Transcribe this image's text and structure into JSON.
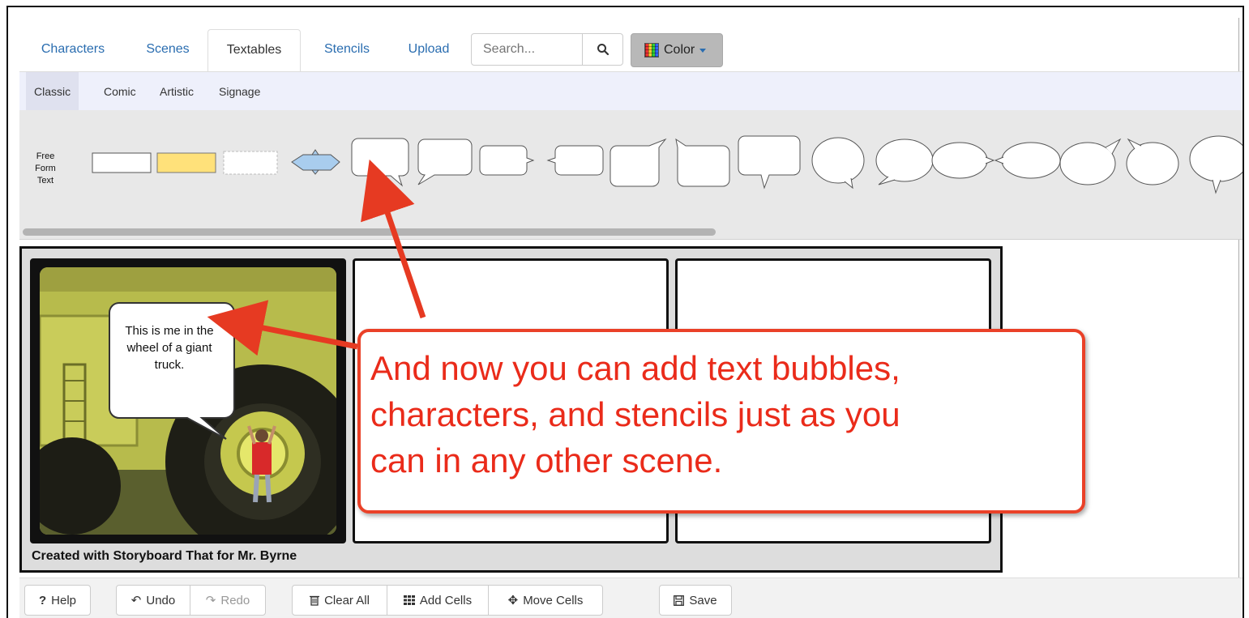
{
  "tabs": [
    {
      "label": "Characters"
    },
    {
      "label": "Scenes"
    },
    {
      "label": "Textables"
    },
    {
      "label": "Stencils"
    },
    {
      "label": "Upload"
    }
  ],
  "search": {
    "placeholder": "Search..."
  },
  "color_button": {
    "label": "Color"
  },
  "subtabs": [
    {
      "label": "Classic"
    },
    {
      "label": "Comic"
    },
    {
      "label": "Artistic"
    },
    {
      "label": "Signage"
    }
  ],
  "textables": {
    "free_form_label_line1": "Free Form",
    "free_form_label_line2": "Text"
  },
  "panel1": {
    "bubble_line1": "This is me in the",
    "bubble_line2": "wheel of a giant",
    "bubble_line3": "truck."
  },
  "storyboard": {
    "credit": "Created with Storyboard That for Mr. Byrne"
  },
  "callout": {
    "line1": "And now you can add text bubbles,",
    "line2": "characters, and stencils just as you",
    "line3": "can in any other scene."
  },
  "toolbar": {
    "help": "Help",
    "undo": "Undo",
    "redo": "Redo",
    "clear_all": "Clear All",
    "add_cells": "Add Cells",
    "move_cells": "Move Cells",
    "save": "Save"
  },
  "colors": {
    "accent_link": "#2a6db0",
    "callout_red": "#ea2b1a",
    "yellow_box": "#ffe17a",
    "blue_shape": "#a9cdee"
  }
}
